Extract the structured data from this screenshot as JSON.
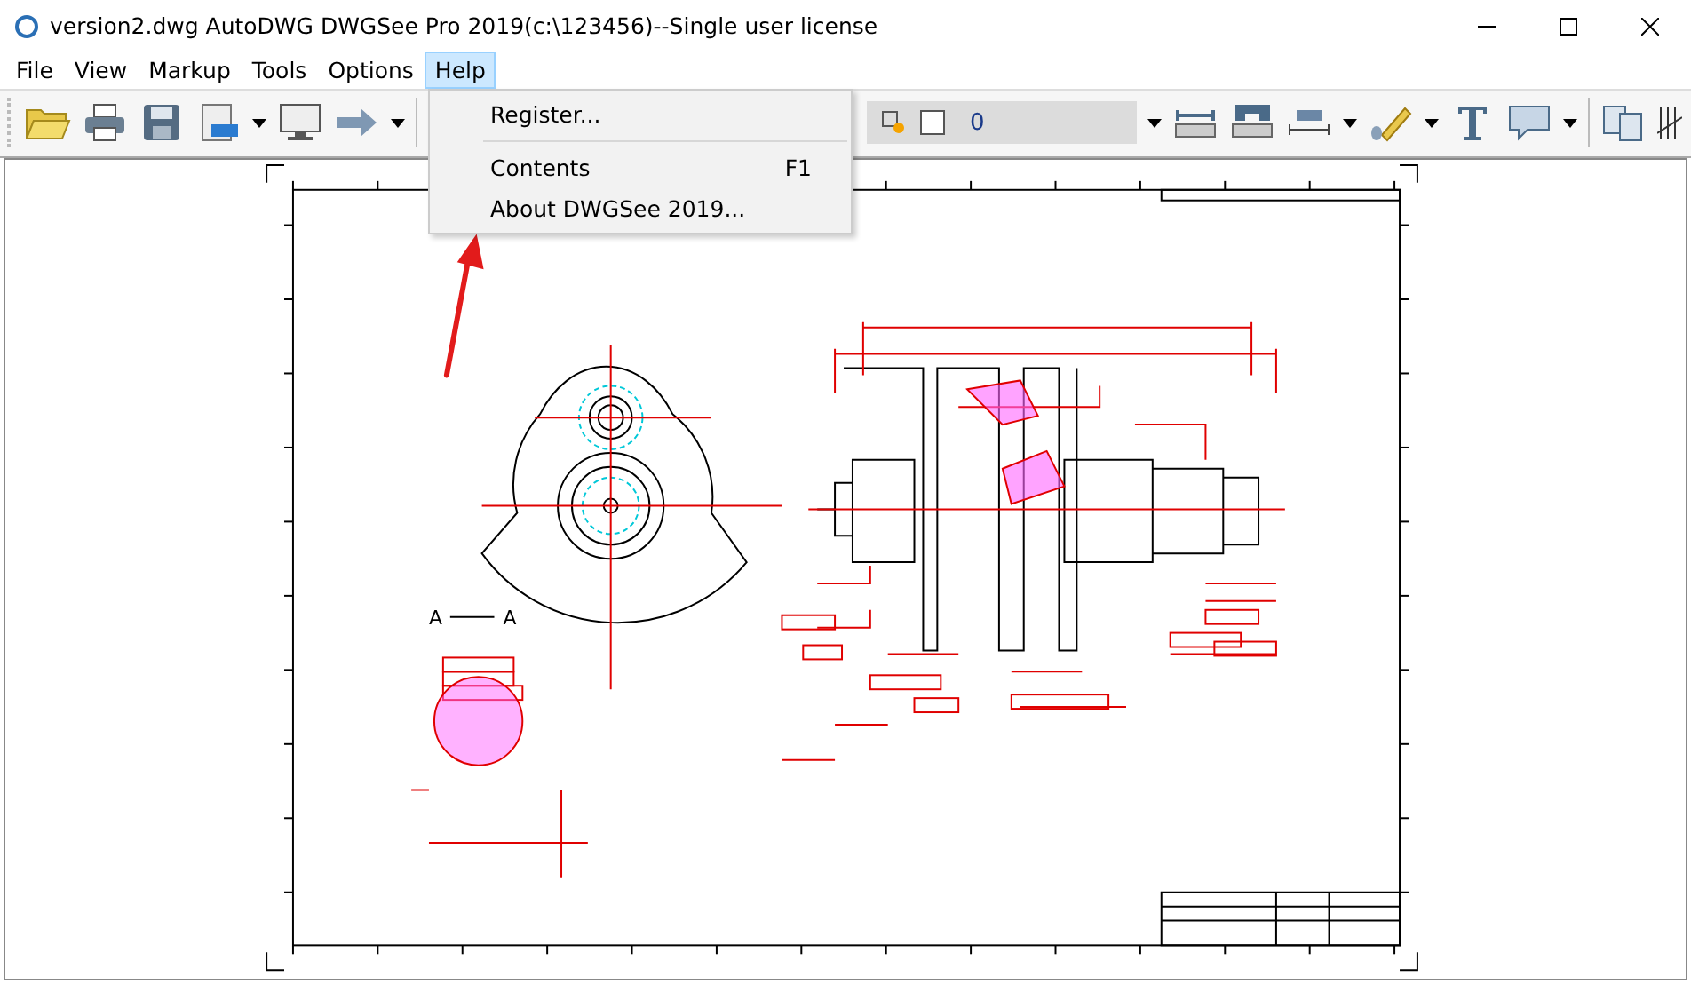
{
  "window": {
    "title": "version2.dwg AutoDWG DWGSee Pro 2019(c:\\123456)--Single user license"
  },
  "menu": [
    {
      "label": "File",
      "selected": false
    },
    {
      "label": "View",
      "selected": false
    },
    {
      "label": "Markup",
      "selected": false
    },
    {
      "label": "Tools",
      "selected": false
    },
    {
      "label": "Options",
      "selected": false
    },
    {
      "label": "Help",
      "selected": true
    }
  ],
  "help_menu": [
    {
      "label": "Register...",
      "separator_after": true
    },
    {
      "label": "Contents",
      "shortcut": "F1",
      "separator_after": false
    },
    {
      "label": "About DWGSee 2019...",
      "separator_after": false
    }
  ],
  "toolbar": {
    "layer_value": "0"
  },
  "drawing": {
    "section_label_left": "A",
    "section_label_right": "A"
  }
}
